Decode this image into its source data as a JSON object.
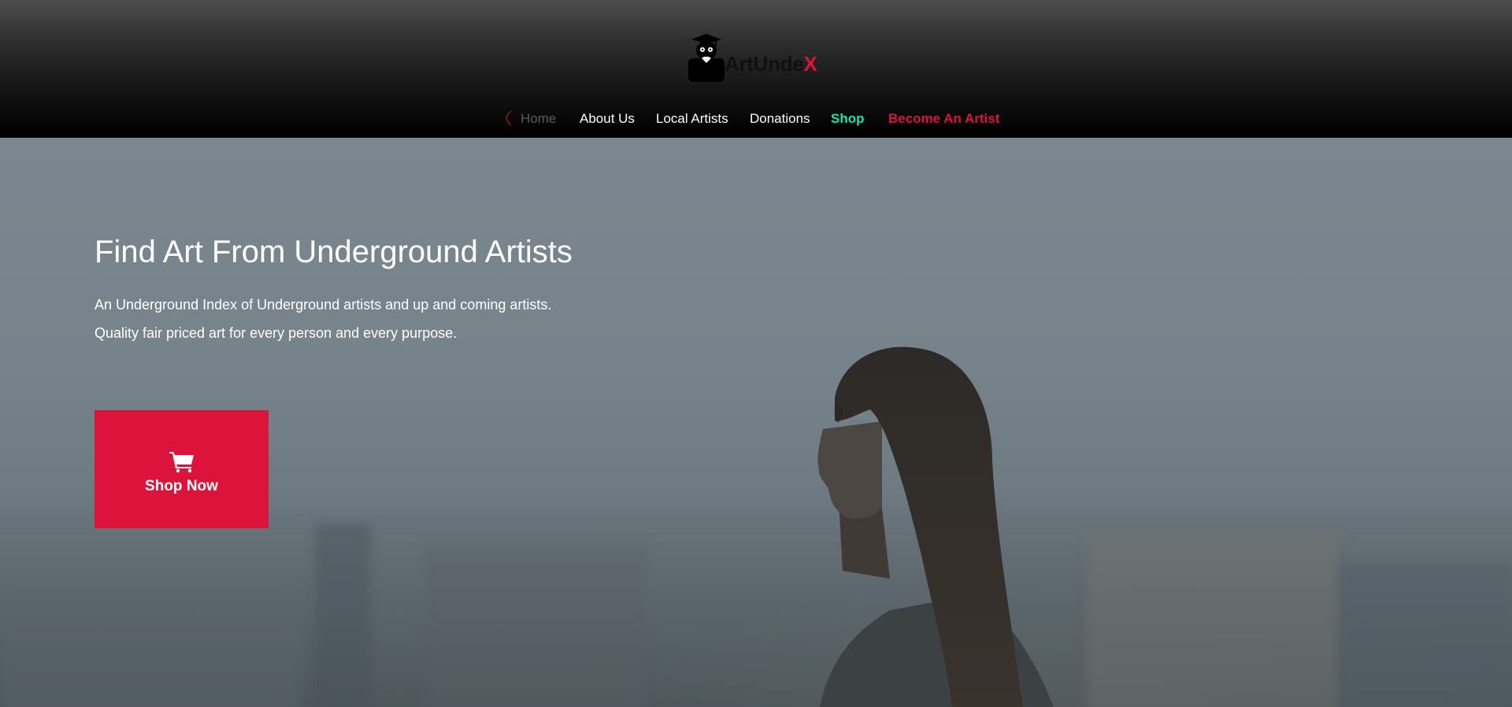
{
  "brand": {
    "name_main": "ArtUnde",
    "name_accent": "X",
    "logo_icon": "owl-graduate-mascot-icon",
    "accent_color": "#dc143c"
  },
  "nav": {
    "items": [
      {
        "label": "Home",
        "state": "active"
      },
      {
        "label": "About Us"
      },
      {
        "label": "Local Artists"
      },
      {
        "label": "Donations"
      },
      {
        "label": "Shop",
        "color": "#19e3b1"
      },
      {
        "label": "Become An Artist",
        "color": "#dc143c"
      }
    ]
  },
  "hero": {
    "title": "Find Art From Underground Artists",
    "line1": "An Underground Index of Underground artists and up and coming artists.",
    "line2": "Quality fair priced art for every person and every purpose.",
    "cta": {
      "label": "Shop Now",
      "icon": "shopping-cart-icon",
      "color": "#dc143c"
    }
  }
}
